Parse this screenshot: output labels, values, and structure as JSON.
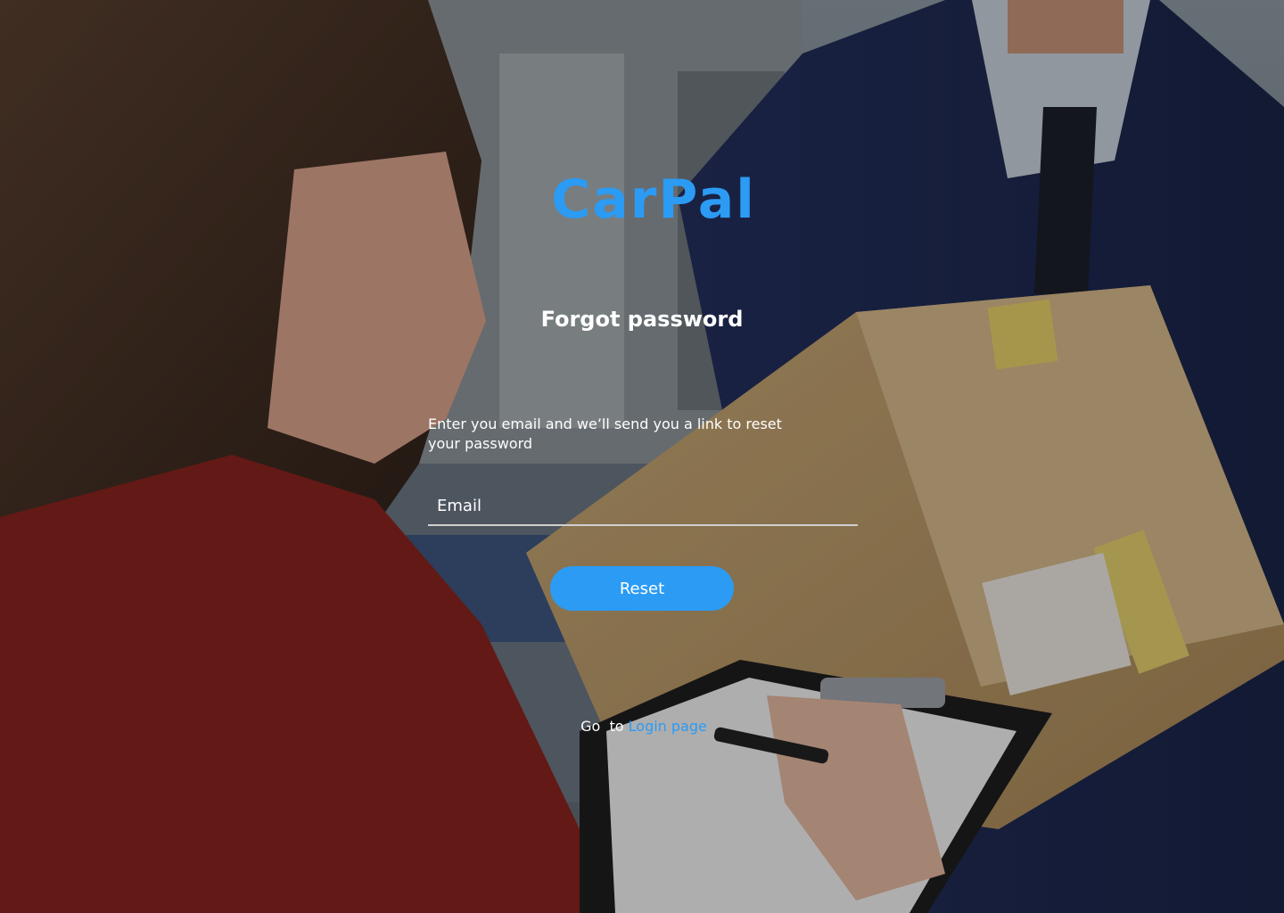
{
  "brand": {
    "name": "CarPal"
  },
  "form": {
    "heading": "Forgot password",
    "instructions": "Enter you email and we’ll send you a link to reset your password",
    "email_placeholder": "Email",
    "reset_label": "Reset"
  },
  "footer": {
    "prefix": "Go  to ",
    "link_label": "Login page"
  },
  "colors": {
    "accent": "#2b9bf4",
    "text": "#ffffff"
  }
}
